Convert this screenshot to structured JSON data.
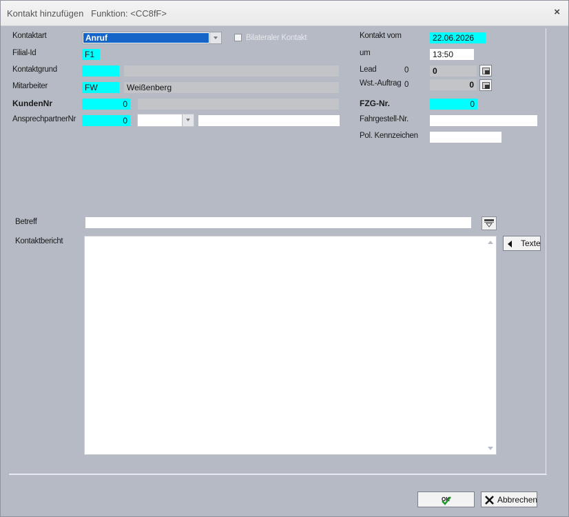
{
  "window": {
    "title": "Kontakt hinzufügen   Funktion: <CC8fF>",
    "close_glyph": "×"
  },
  "left": {
    "kontaktart": {
      "label": "Kontaktart",
      "value": "Anruf"
    },
    "bilateral": {
      "label": "Bilateraler Kontakt",
      "checked": false
    },
    "filial": {
      "label": "Filial-Id",
      "value": "F1"
    },
    "kontaktgrund": {
      "label": "Kontaktgrund",
      "code": "",
      "text": ""
    },
    "mitarbeiter": {
      "label": "Mitarbeiter",
      "code": "FW",
      "name": "Weißenberg"
    },
    "kundennr": {
      "label": "KundenNr",
      "value": "0",
      "name": ""
    },
    "ansprechpartner": {
      "label": "AnsprechpartnerNr",
      "value": "0",
      "select": "",
      "text": ""
    }
  },
  "right": {
    "kontakt_vom": {
      "label": "Kontakt vom",
      "value": "22.06.2026"
    },
    "um": {
      "label": "um",
      "value": "13:50"
    },
    "lead": {
      "label": "Lead",
      "num": "0",
      "value": "0"
    },
    "wst": {
      "label": "Wst.-Auftrag",
      "num": "0",
      "value": "0"
    },
    "fzg": {
      "label": "FZG-Nr.",
      "value": "0"
    },
    "fahrgestell": {
      "label": "Fahrgestell-Nr.",
      "value": ""
    },
    "kennzeichen": {
      "label": "Pol. Kennzeichen",
      "value": ""
    }
  },
  "betreff": {
    "label": "Betreff",
    "value": ""
  },
  "bericht": {
    "label": "Kontaktbericht",
    "value": ""
  },
  "texte_button": {
    "label": "Texte"
  },
  "footer": {
    "ok_label": "OK",
    "cancel_label": "Abbrechen"
  },
  "colors": {
    "highlight": "#00ffff",
    "selection": "#1565c8",
    "background": "#b5bac4"
  }
}
